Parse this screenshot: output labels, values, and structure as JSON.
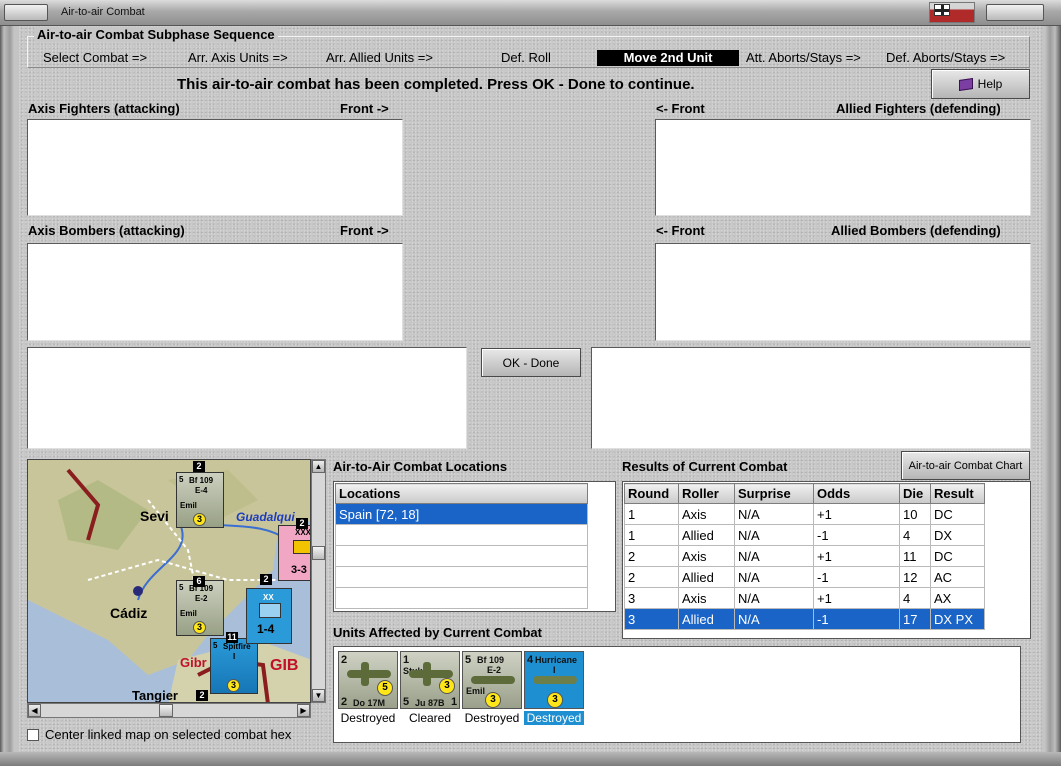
{
  "window": {
    "title": "Air-to-air Combat"
  },
  "sequence": {
    "legend": "Air-to-air Combat Subphase Sequence",
    "steps": [
      "Select Combat =>",
      "Arr. Axis Units =>",
      "Arr. Allied Units =>",
      "Def. Roll",
      "Move 2nd Unit",
      "Att. Aborts/Stays =>",
      "Def. Aborts/Stays =>"
    ],
    "active": "Move 2nd Unit"
  },
  "status_message": "This air-to-air combat has been completed.  Press OK - Done to continue.",
  "help_label": "Help",
  "sections": {
    "axis_fighters": "Axis Fighters (attacking)",
    "allied_fighters": "Allied Fighters (defending)",
    "axis_bombers": "Axis Bombers (attacking)",
    "allied_bombers": "Allied Bombers (defending)",
    "front_right": "Front ->",
    "front_left": "<- Front"
  },
  "ok_done_label": "OK - Done",
  "map": {
    "labels": [
      "Sevi",
      "Guadalqui",
      "Cádiz",
      "Gibr",
      "GIB",
      "Tangier"
    ],
    "counters": [
      {
        "name": "Bf 109",
        "sub": "E-4",
        "pilot": "Emil",
        "strength": "5",
        "pip": "3",
        "stack": "2"
      },
      {
        "name": "Bf 109",
        "sub": "E-2",
        "pilot": "Emil",
        "strength": "5",
        "pip": "3",
        "stack": "6"
      },
      {
        "name": "Spitfire",
        "sub": "I",
        "strength": "5",
        "pip": "3",
        "stack": "11"
      },
      {
        "name": "XXX",
        "value": "3-3",
        "stack": "2"
      },
      {
        "name": "XX",
        "value": "1-4",
        "stack": "2"
      }
    ],
    "stack_extra": "2"
  },
  "center_link_label": "Center linked map on selected combat hex",
  "locations": {
    "title": "Air-to-Air Combat Locations",
    "header": "Locations",
    "rows": [
      "Spain [72, 18]",
      "",
      "",
      "",
      ""
    ]
  },
  "results": {
    "title": "Results of Current Combat",
    "chart_button": "Air-to-air Combat Chart",
    "columns": [
      "Round",
      "Roller",
      "Surprise",
      "Odds",
      "Die",
      "Result"
    ],
    "rows": [
      [
        "1",
        "Axis",
        "N/A",
        "+1",
        "10",
        "DC"
      ],
      [
        "1",
        "Allied",
        "N/A",
        "-1",
        "4",
        "DX"
      ],
      [
        "2",
        "Axis",
        "N/A",
        "+1",
        "11",
        "DC"
      ],
      [
        "2",
        "Allied",
        "N/A",
        "-1",
        "12",
        "AC"
      ],
      [
        "3",
        "Axis",
        "N/A",
        "+1",
        "4",
        "AX"
      ],
      [
        "3",
        "Allied",
        "N/A",
        "-1",
        "17",
        "DX PX"
      ]
    ],
    "selected_row": 5
  },
  "units": {
    "title": "Units Affected by Current Combat",
    "items": [
      {
        "name": "Do 17M",
        "tl": "2",
        "bl": "2",
        "pip": "5",
        "status": "Destroyed"
      },
      {
        "name": "Ju 87B",
        "tl": "1",
        "bl": "5",
        "br": "1",
        "top": "Stuka",
        "pip": "3",
        "status": "Cleared"
      },
      {
        "name": "Bf 109",
        "sub": "E-2",
        "pilot": "Emil",
        "tl": "5",
        "pip": "3",
        "status": "Destroyed"
      },
      {
        "name": "Hurricane",
        "sub": "I",
        "tl": "4",
        "pip": "3",
        "status": "Destroyed"
      }
    ]
  },
  "colors": {
    "selection": "#1a63c7",
    "panel": "#c7c7c7",
    "active_step": "#000000"
  }
}
